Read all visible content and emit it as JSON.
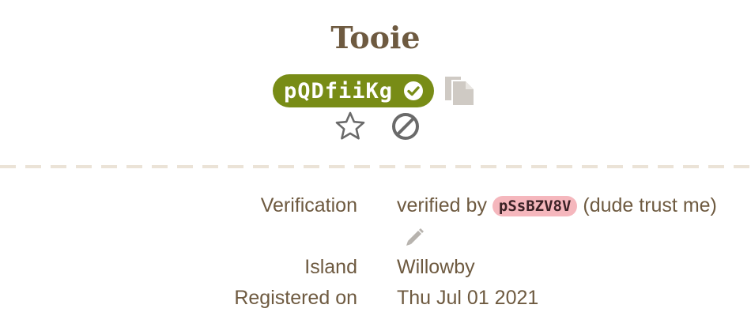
{
  "profile": {
    "name": "Tooie",
    "dream_code": "pQDfiiKg"
  },
  "icons": {
    "verified": "check-circle-icon",
    "copy": "copy-icon",
    "favorite": "star-icon",
    "block": "block-icon",
    "edit": "pencil-icon"
  },
  "colors": {
    "code_pill": "#788c16",
    "friend_code_pill": "#f5b7bd",
    "text": "#6e5a40"
  },
  "details": {
    "verification": {
      "label": "Verification",
      "prefix": "verified by",
      "verifier_code": "pSsBZV8V",
      "note": "(dude trust me)"
    },
    "island": {
      "label": "Island",
      "value": "Willowby"
    },
    "registered": {
      "label": "Registered on",
      "value": "Thu Jul 01 2021"
    }
  }
}
